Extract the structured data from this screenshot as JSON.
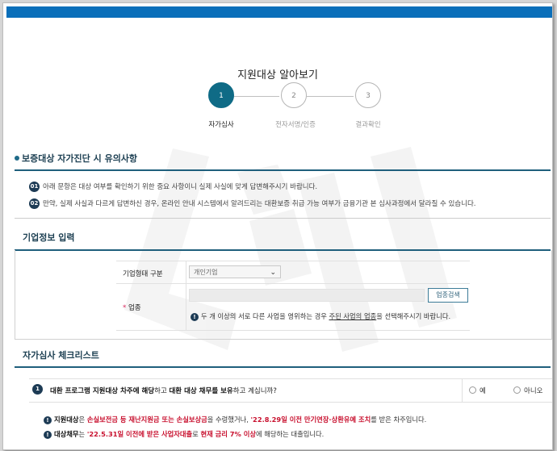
{
  "header": {
    "title": "지원대상 알아보기"
  },
  "steps": [
    {
      "number": "1",
      "label": "자가심사",
      "state": "active"
    },
    {
      "number": "2",
      "label": "전자서명/인증",
      "state": "inactive"
    },
    {
      "number": "3",
      "label": "결과확인",
      "state": "inactive"
    }
  ],
  "notice_section": {
    "title": "보증대상 자가진단 시 유의사항",
    "items": [
      {
        "num": "01",
        "text": "아래 문항은 대상 여부를 확인하기 위한 중요 사항이니 실제 사실에 맞게 답변해주시기 바랍니다."
      },
      {
        "num": "02",
        "text": "만약, 실제 사실과 다르게 답변하신 경우, 온라인 안내 시스템에서 알려드리는 대환보증 취급 가능 여부가 금융기관 본 심사과정에서 달라질 수 있습니다."
      }
    ]
  },
  "company_section": {
    "title": "기업정보 입력",
    "company_type_label": "기업형태 구분",
    "company_type_value": "개인기업",
    "industry_required_mark": "*",
    "industry_label": "업종",
    "industry_search_button": "업종검색",
    "industry_hint": {
      "info_mark": "!",
      "part1": "두 개 이상의 서로 다른 사업을 영위하는 경우 ",
      "underline1": "주된 사업의 업종",
      "part2": "을 선택해주시기 바랍니다."
    }
  },
  "checklist_section": {
    "title": "자가심사 체크리스트",
    "question": {
      "num": "1",
      "p1": "대환 프로그램 지원대상 차주에 해당",
      "p2": "하고 ",
      "p3": "대환 대상 채무를 보유",
      "p4": "하고 계십니까?",
      "yes": "예",
      "no": "아니오"
    },
    "details": [
      {
        "mark": "!",
        "b1": "지원대상",
        "t1": "은 ",
        "r1": "손실보전금 등 재난지원금 또는 손실보상금",
        "t2": "을 수령했거나, ",
        "r2": "'22.8.29일 이전 만기연장·상환유예 조치",
        "t3": "를 받은 차주입니다."
      },
      {
        "mark": "!",
        "b1": "대상채무",
        "t1": "는 ",
        "r1": "'22.5.31일 이전에 받은 사업자대출",
        "t2": "로 ",
        "r2": "현재 금리 7% 이상",
        "t3": "에 해당하는 대출입니다."
      }
    ]
  },
  "colors": {
    "topbar": "#0a6fba",
    "accent": "#0f6b86",
    "highlight": "#c8102e"
  }
}
